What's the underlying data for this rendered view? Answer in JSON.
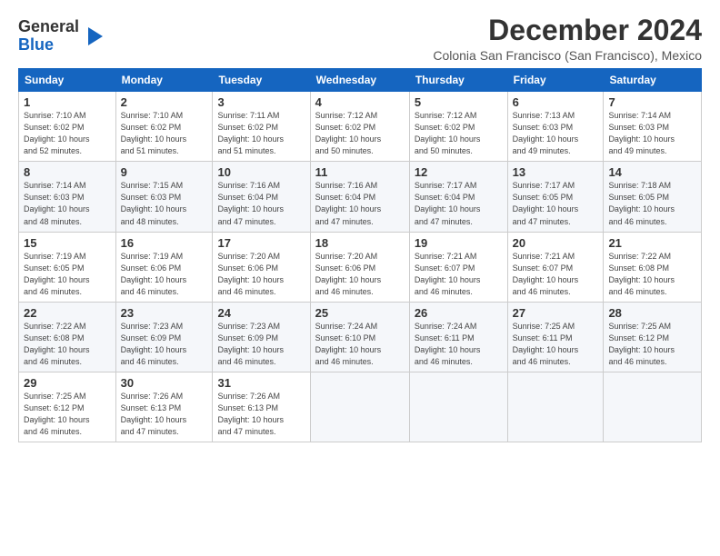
{
  "logo": {
    "general": "General",
    "blue": "Blue"
  },
  "title": "December 2024",
  "subtitle": "Colonia San Francisco (San Francisco), Mexico",
  "days_header": [
    "Sunday",
    "Monday",
    "Tuesday",
    "Wednesday",
    "Thursday",
    "Friday",
    "Saturday"
  ],
  "weeks": [
    [
      {
        "num": "1",
        "info": "Sunrise: 7:10 AM\nSunset: 6:02 PM\nDaylight: 10 hours\nand 52 minutes."
      },
      {
        "num": "2",
        "info": "Sunrise: 7:10 AM\nSunset: 6:02 PM\nDaylight: 10 hours\nand 51 minutes."
      },
      {
        "num": "3",
        "info": "Sunrise: 7:11 AM\nSunset: 6:02 PM\nDaylight: 10 hours\nand 51 minutes."
      },
      {
        "num": "4",
        "info": "Sunrise: 7:12 AM\nSunset: 6:02 PM\nDaylight: 10 hours\nand 50 minutes."
      },
      {
        "num": "5",
        "info": "Sunrise: 7:12 AM\nSunset: 6:02 PM\nDaylight: 10 hours\nand 50 minutes."
      },
      {
        "num": "6",
        "info": "Sunrise: 7:13 AM\nSunset: 6:03 PM\nDaylight: 10 hours\nand 49 minutes."
      },
      {
        "num": "7",
        "info": "Sunrise: 7:14 AM\nSunset: 6:03 PM\nDaylight: 10 hours\nand 49 minutes."
      }
    ],
    [
      {
        "num": "8",
        "info": "Sunrise: 7:14 AM\nSunset: 6:03 PM\nDaylight: 10 hours\nand 48 minutes."
      },
      {
        "num": "9",
        "info": "Sunrise: 7:15 AM\nSunset: 6:03 PM\nDaylight: 10 hours\nand 48 minutes."
      },
      {
        "num": "10",
        "info": "Sunrise: 7:16 AM\nSunset: 6:04 PM\nDaylight: 10 hours\nand 47 minutes."
      },
      {
        "num": "11",
        "info": "Sunrise: 7:16 AM\nSunset: 6:04 PM\nDaylight: 10 hours\nand 47 minutes."
      },
      {
        "num": "12",
        "info": "Sunrise: 7:17 AM\nSunset: 6:04 PM\nDaylight: 10 hours\nand 47 minutes."
      },
      {
        "num": "13",
        "info": "Sunrise: 7:17 AM\nSunset: 6:05 PM\nDaylight: 10 hours\nand 47 minutes."
      },
      {
        "num": "14",
        "info": "Sunrise: 7:18 AM\nSunset: 6:05 PM\nDaylight: 10 hours\nand 46 minutes."
      }
    ],
    [
      {
        "num": "15",
        "info": "Sunrise: 7:19 AM\nSunset: 6:05 PM\nDaylight: 10 hours\nand 46 minutes."
      },
      {
        "num": "16",
        "info": "Sunrise: 7:19 AM\nSunset: 6:06 PM\nDaylight: 10 hours\nand 46 minutes."
      },
      {
        "num": "17",
        "info": "Sunrise: 7:20 AM\nSunset: 6:06 PM\nDaylight: 10 hours\nand 46 minutes."
      },
      {
        "num": "18",
        "info": "Sunrise: 7:20 AM\nSunset: 6:06 PM\nDaylight: 10 hours\nand 46 minutes."
      },
      {
        "num": "19",
        "info": "Sunrise: 7:21 AM\nSunset: 6:07 PM\nDaylight: 10 hours\nand 46 minutes."
      },
      {
        "num": "20",
        "info": "Sunrise: 7:21 AM\nSunset: 6:07 PM\nDaylight: 10 hours\nand 46 minutes."
      },
      {
        "num": "21",
        "info": "Sunrise: 7:22 AM\nSunset: 6:08 PM\nDaylight: 10 hours\nand 46 minutes."
      }
    ],
    [
      {
        "num": "22",
        "info": "Sunrise: 7:22 AM\nSunset: 6:08 PM\nDaylight: 10 hours\nand 46 minutes."
      },
      {
        "num": "23",
        "info": "Sunrise: 7:23 AM\nSunset: 6:09 PM\nDaylight: 10 hours\nand 46 minutes."
      },
      {
        "num": "24",
        "info": "Sunrise: 7:23 AM\nSunset: 6:09 PM\nDaylight: 10 hours\nand 46 minutes."
      },
      {
        "num": "25",
        "info": "Sunrise: 7:24 AM\nSunset: 6:10 PM\nDaylight: 10 hours\nand 46 minutes."
      },
      {
        "num": "26",
        "info": "Sunrise: 7:24 AM\nSunset: 6:11 PM\nDaylight: 10 hours\nand 46 minutes."
      },
      {
        "num": "27",
        "info": "Sunrise: 7:25 AM\nSunset: 6:11 PM\nDaylight: 10 hours\nand 46 minutes."
      },
      {
        "num": "28",
        "info": "Sunrise: 7:25 AM\nSunset: 6:12 PM\nDaylight: 10 hours\nand 46 minutes."
      }
    ],
    [
      {
        "num": "29",
        "info": "Sunrise: 7:25 AM\nSunset: 6:12 PM\nDaylight: 10 hours\nand 46 minutes."
      },
      {
        "num": "30",
        "info": "Sunrise: 7:26 AM\nSunset: 6:13 PM\nDaylight: 10 hours\nand 47 minutes."
      },
      {
        "num": "31",
        "info": "Sunrise: 7:26 AM\nSunset: 6:13 PM\nDaylight: 10 hours\nand 47 minutes."
      },
      {
        "num": "",
        "info": ""
      },
      {
        "num": "",
        "info": ""
      },
      {
        "num": "",
        "info": ""
      },
      {
        "num": "",
        "info": ""
      }
    ]
  ]
}
